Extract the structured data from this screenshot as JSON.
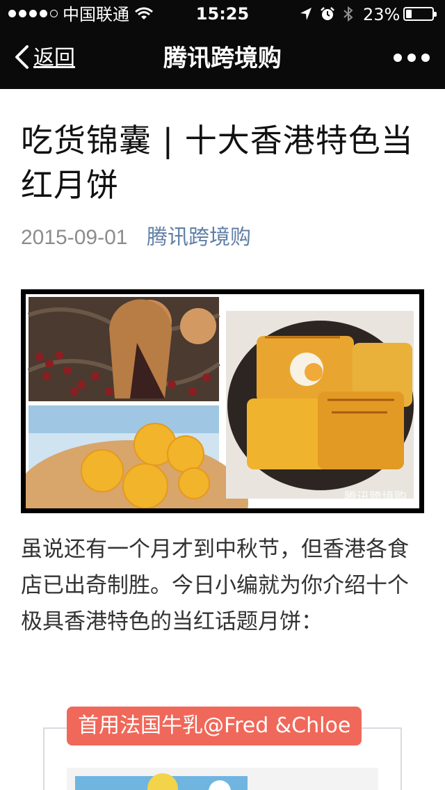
{
  "status_bar": {
    "carrier": "中国联通",
    "time": "15:25",
    "battery_percent": "23%",
    "battery_level": 0.23,
    "signal_bars_filled": 4,
    "signal_bars_total": 5
  },
  "nav": {
    "back_label": "返回",
    "title": "腾讯跨境购"
  },
  "article": {
    "title": "吃货锦囊 | 十大香港特色当红月饼",
    "date": "2015-09-01",
    "source": "腾讯跨境购",
    "hero_image": {
      "icon": "mooncake-collage-image",
      "watermark": "腾讯跨境购"
    },
    "body": "虽说还有一个月才到中秋节，但香港各食店已出奇制胜。今日小编就为你介绍十个极具香港特色的当红话题月饼："
  },
  "section": {
    "tag": "首用法国牛乳@Fred &Chloe"
  },
  "colors": {
    "bar_background": "#0a0a0a",
    "link_blue": "#607fa6",
    "tag_red": "#f0685a",
    "meta_gray": "#8c8c8c"
  }
}
